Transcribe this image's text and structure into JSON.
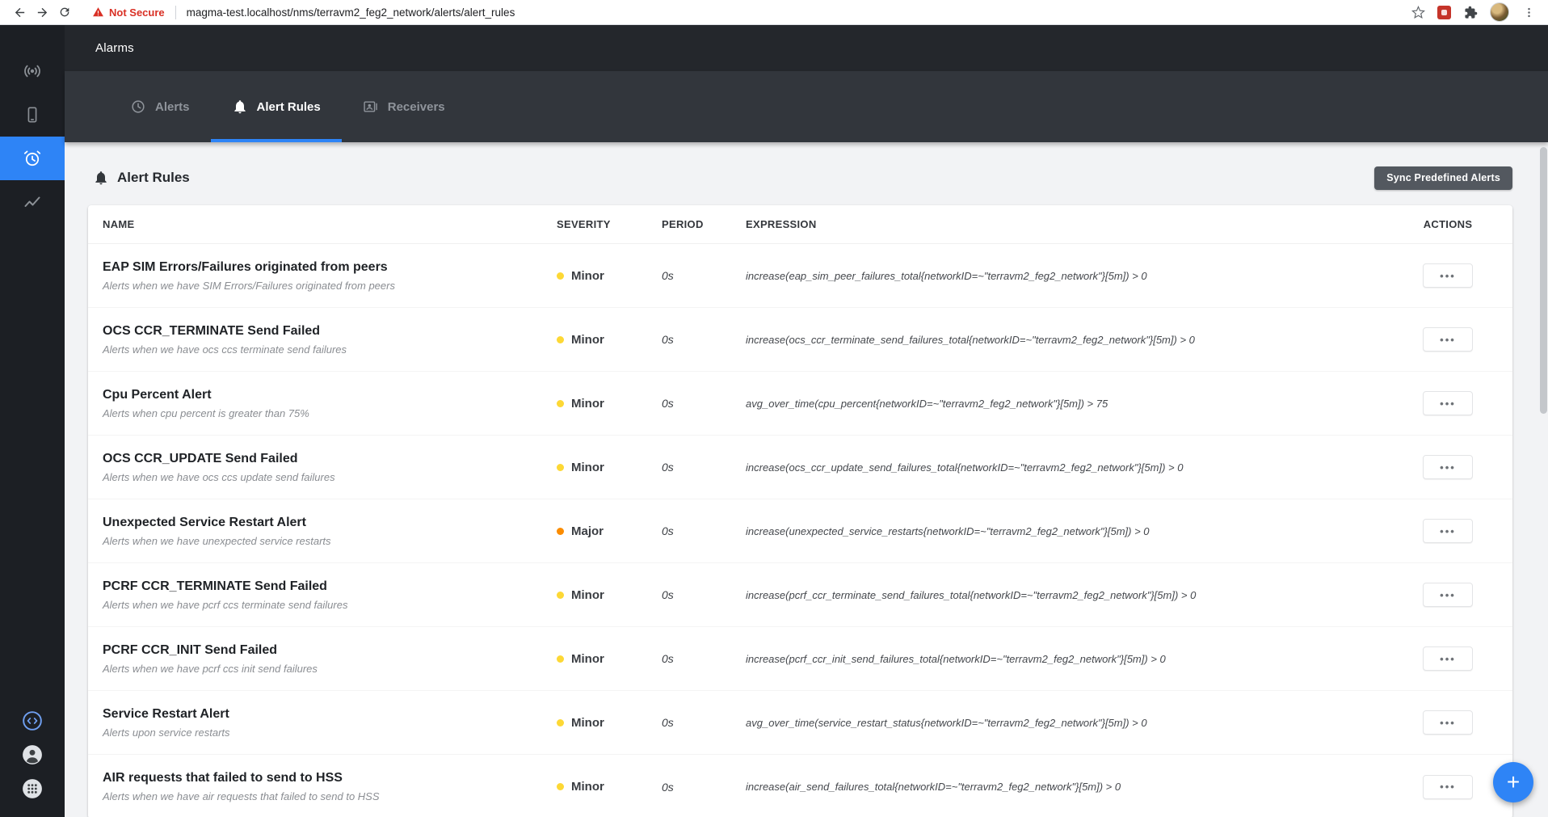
{
  "colors": {
    "accent": "#2e84f6",
    "not_secure": "#d93025",
    "severity": {
      "Minor": "#fdd835",
      "Major": "#fb8c00"
    }
  },
  "browser": {
    "security_label": "Not Secure",
    "url": "magma-test.localhost/nms/terravm2_feg2_network/alerts/alert_rules"
  },
  "header": {
    "title": "Alarms"
  },
  "tabs": [
    {
      "label": "Alerts",
      "icon": "clock-icon",
      "active": false
    },
    {
      "label": "Alert Rules",
      "icon": "bell-icon",
      "active": true
    },
    {
      "label": "Receivers",
      "icon": "contacts-icon",
      "active": false
    }
  ],
  "main": {
    "title": "Alert Rules",
    "sync_button_label": "Sync Predefined Alerts",
    "fab_label": "+",
    "table": {
      "columns": [
        "NAME",
        "SEVERITY",
        "PERIOD",
        "EXPRESSION",
        "ACTIONS"
      ],
      "actions_icon": "•••",
      "rows": [
        {
          "name": "EAP SIM Errors/Failures originated from peers",
          "description": "Alerts when we have SIM Errors/Failures originated from peers",
          "severity": "Minor",
          "period": "0s",
          "expression": "increase(eap_sim_peer_failures_total{networkID=~\"terravm2_feg2_network\"}[5m]) > 0"
        },
        {
          "name": "OCS CCR_TERMINATE Send Failed",
          "description": "Alerts when we have ocs ccs terminate send failures",
          "severity": "Minor",
          "period": "0s",
          "expression": "increase(ocs_ccr_terminate_send_failures_total{networkID=~\"terravm2_feg2_network\"}[5m]) > 0"
        },
        {
          "name": "Cpu Percent Alert",
          "description": "Alerts when cpu percent is greater than 75%",
          "severity": "Minor",
          "period": "0s",
          "expression": "avg_over_time(cpu_percent{networkID=~\"terravm2_feg2_network\"}[5m]) > 75"
        },
        {
          "name": "OCS CCR_UPDATE Send Failed",
          "description": "Alerts when we have ocs ccs update send failures",
          "severity": "Minor",
          "period": "0s",
          "expression": "increase(ocs_ccr_update_send_failures_total{networkID=~\"terravm2_feg2_network\"}[5m]) > 0"
        },
        {
          "name": "Unexpected Service Restart Alert",
          "description": "Alerts when we have unexpected service restarts",
          "severity": "Major",
          "period": "0s",
          "expression": "increase(unexpected_service_restarts{networkID=~\"terravm2_feg2_network\"}[5m]) > 0"
        },
        {
          "name": "PCRF CCR_TERMINATE Send Failed",
          "description": "Alerts when we have pcrf ccs terminate send failures",
          "severity": "Minor",
          "period": "0s",
          "expression": "increase(pcrf_ccr_terminate_send_failures_total{networkID=~\"terravm2_feg2_network\"}[5m]) > 0"
        },
        {
          "name": "PCRF CCR_INIT Send Failed",
          "description": "Alerts when we have pcrf ccs init send failures",
          "severity": "Minor",
          "period": "0s",
          "expression": "increase(pcrf_ccr_init_send_failures_total{networkID=~\"terravm2_feg2_network\"}[5m]) > 0"
        },
        {
          "name": "Service Restart Alert",
          "description": "Alerts upon service restarts",
          "severity": "Minor",
          "period": "0s",
          "expression": "avg_over_time(service_restart_status{networkID=~\"terravm2_feg2_network\"}[5m]) > 0"
        },
        {
          "name": "AIR requests that failed to send to HSS",
          "description": "Alerts when we have air requests that failed to send to HSS",
          "severity": "Minor",
          "period": "0s",
          "expression": "increase(air_send_failures_total{networkID=~\"terravm2_feg2_network\"}[5m]) > 0"
        }
      ]
    }
  }
}
